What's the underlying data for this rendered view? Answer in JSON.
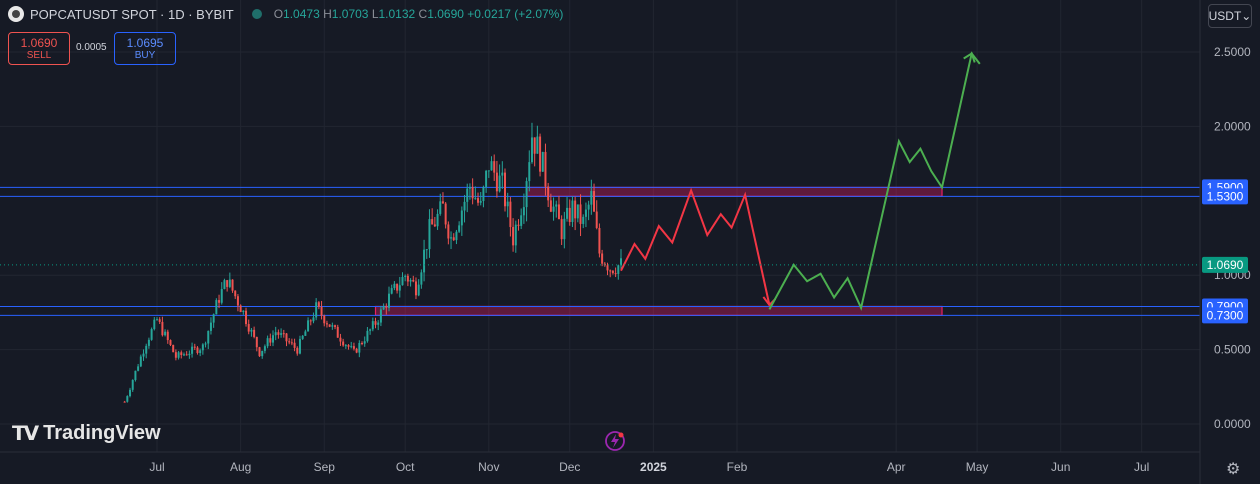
{
  "header": {
    "symbol": "POPCATUSDT SPOT · 1D · BYBIT",
    "o_label": "O",
    "o_value": "1.0473",
    "h_label": "H",
    "h_value": "1.0703",
    "l_label": "L",
    "l_value": "1.0132",
    "c_label": "C",
    "c_value": "1.0690",
    "change": "+0.0217 (+2.07%)"
  },
  "trade": {
    "sell_price": "1.0690",
    "sell_label": "SELL",
    "spread": "0.0005",
    "buy_price": "1.0695",
    "buy_label": "BUY"
  },
  "currency_button": "USDT⌄",
  "branding": "TradingView",
  "colors": {
    "background": "#161a25",
    "up": "#26a69a",
    "down": "#ef5350",
    "level_line": "#2962ff",
    "zone_fill": "#e91e63",
    "projection_down": "#f23645",
    "projection_up": "#4caf50",
    "last_price": "#089981"
  },
  "chart_data": {
    "type": "candlestick",
    "x_ticks": [
      "Jul",
      "Aug",
      "Sep",
      "Oct",
      "Nov",
      "Dec",
      "2025",
      "Feb",
      "Apr",
      "May",
      "Jun",
      "Jul"
    ],
    "y_ticks": [
      "0.0000",
      "0.5000",
      "1.0000",
      "2.0000",
      "2.5000"
    ],
    "ylim": [
      -0.1,
      2.7
    ],
    "last_price": 1.069,
    "levels": [
      1.59,
      1.53,
      0.79,
      0.73
    ],
    "zones": [
      {
        "from_date": "2024-11-15",
        "to_date": "2025-04-18",
        "low": 1.53,
        "high": 1.59
      },
      {
        "from_date": "2024-09-20",
        "to_date": "2025-04-18",
        "low": 0.73,
        "high": 0.79
      }
    ],
    "anchors": [
      {
        "date": "2024-06-19",
        "price": 0.15
      },
      {
        "date": "2024-06-27",
        "price": 0.55
      },
      {
        "date": "2024-07-01",
        "price": 0.7
      },
      {
        "date": "2024-07-08",
        "price": 0.45
      },
      {
        "date": "2024-07-18",
        "price": 0.52
      },
      {
        "date": "2024-07-24",
        "price": 0.85
      },
      {
        "date": "2024-07-27",
        "price": 0.97
      },
      {
        "date": "2024-08-02",
        "price": 0.75
      },
      {
        "date": "2024-08-08",
        "price": 0.48
      },
      {
        "date": "2024-08-14",
        "price": 0.62
      },
      {
        "date": "2024-08-22",
        "price": 0.5
      },
      {
        "date": "2024-08-29",
        "price": 0.78
      },
      {
        "date": "2024-09-06",
        "price": 0.6
      },
      {
        "date": "2024-09-12",
        "price": 0.48
      },
      {
        "date": "2024-09-20",
        "price": 0.68
      },
      {
        "date": "2024-09-25",
        "price": 0.85
      },
      {
        "date": "2024-10-01",
        "price": 1.0
      },
      {
        "date": "2024-10-05",
        "price": 0.92
      },
      {
        "date": "2024-10-10",
        "price": 1.3
      },
      {
        "date": "2024-10-15",
        "price": 1.45
      },
      {
        "date": "2024-10-18",
        "price": 1.25
      },
      {
        "date": "2024-10-25",
        "price": 1.6
      },
      {
        "date": "2024-10-29",
        "price": 1.45
      },
      {
        "date": "2024-11-01",
        "price": 1.75
      },
      {
        "date": "2024-11-06",
        "price": 1.6
      },
      {
        "date": "2024-11-10",
        "price": 1.25
      },
      {
        "date": "2024-11-14",
        "price": 1.55
      },
      {
        "date": "2024-11-17",
        "price": 1.95
      },
      {
        "date": "2024-11-20",
        "price": 1.8
      },
      {
        "date": "2024-11-24",
        "price": 1.5
      },
      {
        "date": "2024-11-28",
        "price": 1.3
      },
      {
        "date": "2024-12-02",
        "price": 1.45
      },
      {
        "date": "2024-12-06",
        "price": 1.35
      },
      {
        "date": "2024-12-09",
        "price": 1.52
      },
      {
        "date": "2024-12-12",
        "price": 1.15
      },
      {
        "date": "2024-12-16",
        "price": 1.05
      },
      {
        "date": "2024-12-20",
        "price": 1.07
      }
    ],
    "projection_down": [
      {
        "date": "2024-12-20",
        "price": 1.03
      },
      {
        "date": "2024-12-25",
        "price": 1.21
      },
      {
        "date": "2024-12-29",
        "price": 1.11
      },
      {
        "date": "2025-01-03",
        "price": 1.33
      },
      {
        "date": "2025-01-08",
        "price": 1.22
      },
      {
        "date": "2025-01-15",
        "price": 1.57
      },
      {
        "date": "2025-01-21",
        "price": 1.27
      },
      {
        "date": "2025-01-26",
        "price": 1.41
      },
      {
        "date": "2025-01-30",
        "price": 1.32
      },
      {
        "date": "2025-02-04",
        "price": 1.54
      },
      {
        "date": "2025-02-13",
        "price": 0.8
      }
    ],
    "projection_up": [
      {
        "date": "2025-02-13",
        "price": 0.77
      },
      {
        "date": "2025-02-22",
        "price": 1.07
      },
      {
        "date": "2025-02-27",
        "price": 0.96
      },
      {
        "date": "2025-03-04",
        "price": 1.01
      },
      {
        "date": "2025-03-09",
        "price": 0.85
      },
      {
        "date": "2025-03-14",
        "price": 0.98
      },
      {
        "date": "2025-03-19",
        "price": 0.78
      },
      {
        "date": "2025-04-02",
        "price": 1.9
      },
      {
        "date": "2025-04-06",
        "price": 1.76
      },
      {
        "date": "2025-04-10",
        "price": 1.85
      },
      {
        "date": "2025-04-14",
        "price": 1.7
      },
      {
        "date": "2025-04-18",
        "price": 1.59
      },
      {
        "date": "2025-04-29",
        "price": 2.49
      },
      {
        "date": "2025-05-02",
        "price": 2.42
      }
    ],
    "price_labels": [
      "1.5900",
      "1.5300",
      "1.0690",
      "0.7900",
      "0.7300"
    ]
  }
}
